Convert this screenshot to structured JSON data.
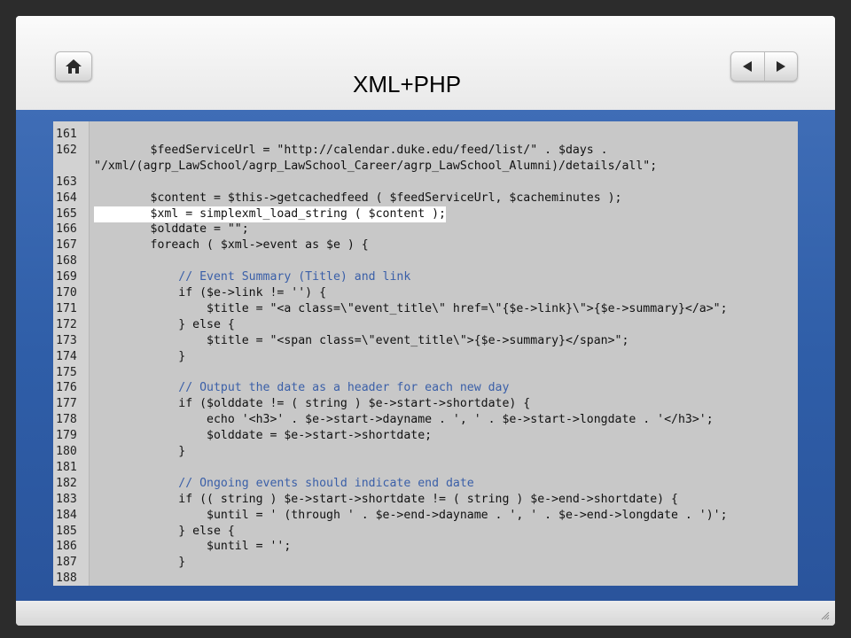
{
  "header": {
    "title": "XML+PHP",
    "home_icon": "home-icon",
    "prev_icon": "triangle-left-icon",
    "next_icon": "triangle-right-icon"
  },
  "code_lines": [
    {
      "n": "161",
      "t": ""
    },
    {
      "n": "162",
      "t": "        $feedServiceUrl = \"http://calendar.duke.edu/feed/list/\" . $days ."
    },
    {
      "n": "",
      "t": "\"/xml/(agrp_LawSchool/agrp_LawSchool_Career/agrp_LawSchool_Alumni)/details/all\";"
    },
    {
      "n": "163",
      "t": ""
    },
    {
      "n": "164",
      "t": "        $content = $this->getcachedfeed ( $feedServiceUrl, $cacheminutes );"
    },
    {
      "n": "165",
      "t": "        $xml = simplexml_load_string ( $content );",
      "hl": true
    },
    {
      "n": "166",
      "t": "        $olddate = \"\";"
    },
    {
      "n": "167",
      "t": "        foreach ( $xml->event as $e ) {"
    },
    {
      "n": "168",
      "t": ""
    },
    {
      "n": "169",
      "t": "            // Event Summary (Title) and link"
    },
    {
      "n": "170",
      "t": "            if ($e->link != '') {"
    },
    {
      "n": "171",
      "t": "                $title = \"<a class=\\\"event_title\\\" href=\\\"{$e->link}\\\">{$e->summary}</a>\";"
    },
    {
      "n": "172",
      "t": "            } else {"
    },
    {
      "n": "173",
      "t": "                $title = \"<span class=\\\"event_title\\\">{$e->summary}</span>\";"
    },
    {
      "n": "174",
      "t": "            }"
    },
    {
      "n": "175",
      "t": ""
    },
    {
      "n": "176",
      "t": "            // Output the date as a header for each new day"
    },
    {
      "n": "177",
      "t": "            if ($olddate != ( string ) $e->start->shortdate) {"
    },
    {
      "n": "178",
      "t": "                echo '<h3>' . $e->start->dayname . ', ' . $e->start->longdate . '</h3>';"
    },
    {
      "n": "179",
      "t": "                $olddate = $e->start->shortdate;"
    },
    {
      "n": "180",
      "t": "            }"
    },
    {
      "n": "181",
      "t": ""
    },
    {
      "n": "182",
      "t": "            // Ongoing events should indicate end date"
    },
    {
      "n": "183",
      "t": "            if (( string ) $e->start->shortdate != ( string ) $e->end->shortdate) {"
    },
    {
      "n": "184",
      "t": "                $until = ' (through ' . $e->end->dayname . ', ' . $e->end->longdate . ')';"
    },
    {
      "n": "185",
      "t": "            } else {"
    },
    {
      "n": "186",
      "t": "                $until = '';"
    },
    {
      "n": "187",
      "t": "            }"
    },
    {
      "n": "188",
      "t": ""
    }
  ]
}
